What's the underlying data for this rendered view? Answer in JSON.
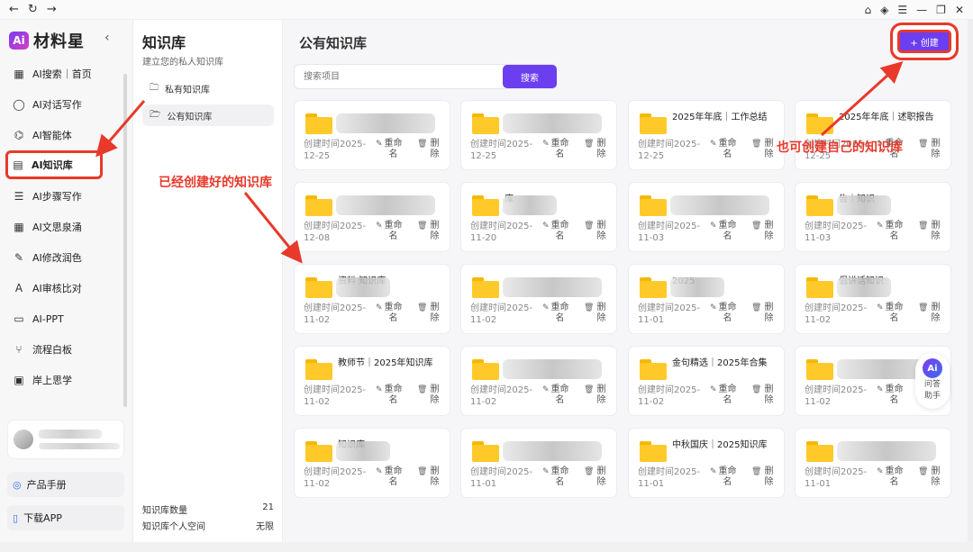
{
  "topbar": {
    "back_icon": "←",
    "reload_icon": "↻",
    "forward_icon": "→",
    "home_icon": "⌂",
    "shield_icon": "◈",
    "list_icon": "☰",
    "min_icon": "—",
    "restore_icon": "❐",
    "close_icon": "✕"
  },
  "app": {
    "logo_mark": "Ai",
    "logo_text": "材料星",
    "collapse_icon": "‹"
  },
  "sidebar": {
    "items": [
      {
        "icon": "▦",
        "label": "AI搜索｜首页"
      },
      {
        "icon": "◯",
        "label": "AI对话写作"
      },
      {
        "icon": "⌬",
        "label": "AI智能体"
      },
      {
        "icon": "▤",
        "label": "AI知识库"
      },
      {
        "icon": "☰",
        "label": "AI步骤写作"
      },
      {
        "icon": "▦",
        "label": "AI文思泉涌"
      },
      {
        "icon": "✎",
        "label": "AI修改润色"
      },
      {
        "icon": "A",
        "label": "AI审核比对"
      },
      {
        "icon": "▭",
        "label": "AI-PPT"
      },
      {
        "icon": "⑂",
        "label": "流程白板"
      },
      {
        "icon": "▣",
        "label": "岸上思学"
      }
    ],
    "manual": "产品手册",
    "download": "下载APP"
  },
  "kbpanel": {
    "title": "知识库",
    "subtitle": "建立您的私人知识库",
    "private": "私有知识库",
    "public": "公有知识库",
    "count_label": "知识库数量",
    "count_value": "21",
    "space_label": "知识库个人空间",
    "space_value": "无限"
  },
  "main": {
    "title": "公有知识库",
    "create_label": "+ 创建",
    "search_placeholder": "搜索项目",
    "search_button": "搜索",
    "rename_label": "重命名",
    "delete_label": "删除",
    "cards": [
      {
        "title": "",
        "date": "创建时间2025-12-25"
      },
      {
        "title": "",
        "date": "创建时间2025-12-25"
      },
      {
        "title": "2025年年底｜工作总结",
        "date": "创建时间2025-12-25"
      },
      {
        "title": "2025年年底｜述职报告",
        "date": "创建时间2025-12-25"
      },
      {
        "title": "",
        "date": "创建时间2025-12-08"
      },
      {
        "title": "库",
        "date": "创建时间2025-11-20"
      },
      {
        "title": "",
        "date": "创建时间2025-11-03"
      },
      {
        "title": "告｜知识",
        "date": "创建时间2025-11-03"
      },
      {
        "title": "资料 知识库",
        "date": "创建时间2025-11-02"
      },
      {
        "title": "",
        "date": "创建时间2025-11-02"
      },
      {
        "title": "2025",
        "date": "创建时间2025-11-01"
      },
      {
        "title": "倡讲话知识",
        "date": "创建时间2025-11-02"
      },
      {
        "title": "教师节｜2025年知识库",
        "date": "创建时间2025-11-02"
      },
      {
        "title": "",
        "date": "创建时间2025-11-02"
      },
      {
        "title": "金句精选｜2025年合集",
        "date": "创建时间2025-11-02"
      },
      {
        "title": "",
        "date": "创建时间2025-11-02"
      },
      {
        "title": "知识库",
        "date": "创建时间2025-11-02"
      },
      {
        "title": "",
        "date": "创建时间2025-11-01"
      },
      {
        "title": "中秋国庆｜2025知识库",
        "date": "创建时间2025-11-01"
      },
      {
        "title": "",
        "date": "创建时间2025-11-01"
      }
    ]
  },
  "annotations": {
    "existing": "已经创建好的知识库",
    "create_own": "也可创建自己的知识库"
  },
  "qa": {
    "logo": "Ai",
    "label_line1": "问答",
    "label_line2": "助手"
  },
  "colors": {
    "accent": "#6b3ef0",
    "annotation_red": "#e8392a",
    "folder_yellow": "#ffc929"
  }
}
